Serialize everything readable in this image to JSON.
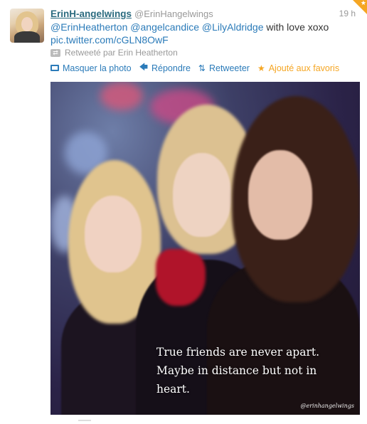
{
  "tweet": {
    "fullname": "ErinH-angelwings",
    "username": "@ErinHangelwings",
    "time": "19 h",
    "text": {
      "mention1": "@ErinHeatherton",
      "mention2": "@angelcandice",
      "mention3": "@LilyAldridge",
      "plain": "with love xoxo",
      "link": "pic.twitter.com/cGLN8OwF"
    },
    "retweeted_by": "Retweeté par Erin Heatherton",
    "actions": {
      "hide_photo": "Masquer la photo",
      "reply": "Répondre",
      "retweet": "Retweeter",
      "favorited": "Ajouté aux favoris"
    },
    "photo": {
      "quote_line1": "True friends are never apart.",
      "quote_line2": "Maybe in distance but not in",
      "quote_line3": "heart.",
      "watermark": "@erinhangelwings"
    }
  },
  "icons": {
    "retweeted": "retweet-icon",
    "hide_photo": "photo-icon",
    "reply": "reply-arrow-icon",
    "retweet": "retweet-arrows-icon",
    "favorite": "star-icon",
    "corner": "favorited-corner-icon"
  },
  "colors": {
    "link": "#2b7bb9",
    "name": "#2b6b7f",
    "favorite": "#f5a623",
    "muted": "#999999"
  }
}
